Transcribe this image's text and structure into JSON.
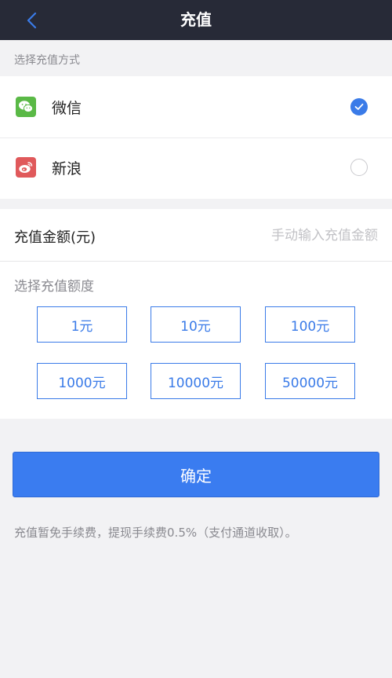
{
  "nav": {
    "title": "充值",
    "back_icon": "chevron-left-icon",
    "back_color": "#3a7be8"
  },
  "payment_section": {
    "label": "选择充值方式",
    "methods": [
      {
        "name": "微信",
        "icon": "wechat-icon",
        "icon_color": "#5ab946",
        "selected": true
      },
      {
        "name": "新浪",
        "icon": "weibo-icon",
        "icon_color": "#e0595b",
        "selected": false
      }
    ]
  },
  "amount": {
    "label": "充值金额(元)",
    "placeholder": "手动输入充值金额",
    "value": ""
  },
  "quota": {
    "label": "选择充值额度",
    "options": [
      "1元",
      "10元",
      "100元",
      "1000元",
      "10000元",
      "50000元"
    ]
  },
  "confirm_label": "确定",
  "note": "充值暂免手续费，提现手续费0.5%（支付通道收取）。",
  "colors": {
    "accent": "#3a7be8",
    "nav_bg": "#272a37"
  }
}
